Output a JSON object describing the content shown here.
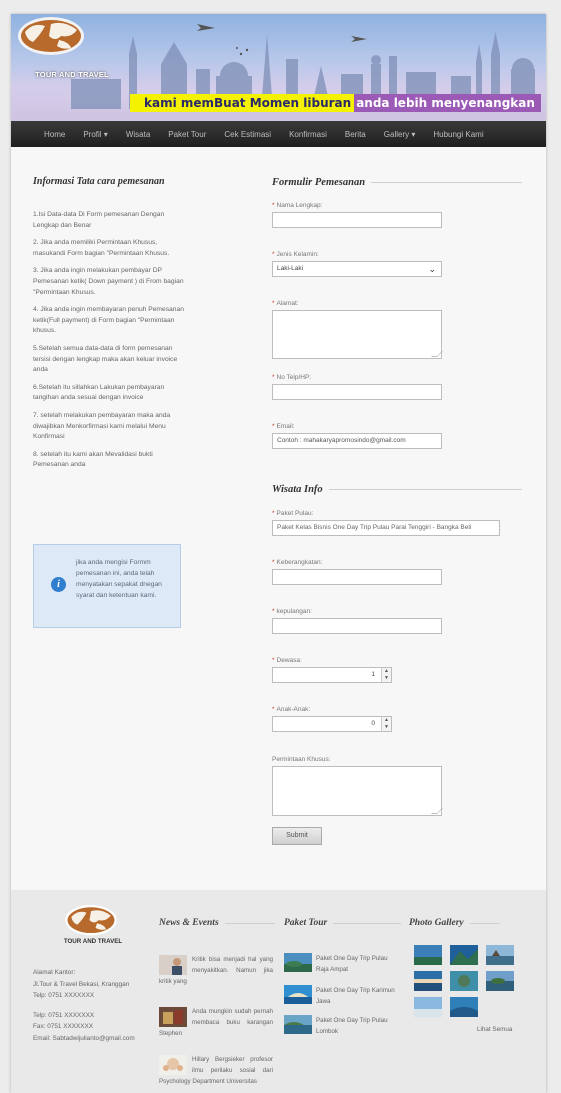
{
  "brand": {
    "logo_text": "TOUR AND TRAVEL",
    "tagline_highlight": "kami memBuat Momen liburan",
    "tagline_rest": "anda lebih menyenangkan"
  },
  "nav": {
    "items": [
      "Home",
      "Profil ▾",
      "Wisata",
      "Paket Tour",
      "Cek Estimasi",
      "Konfirmasi",
      "Berita",
      "Gallery ▾",
      "Hubungi Kami"
    ]
  },
  "info": {
    "title": "Informasi Tata cara pemesanan",
    "steps": [
      "1.Isi Data-data Di Form pemesanan Dengan Lengkap dan Benar",
      "2. Jika anda memiliki Permintaan Khusus, masukandi Form bagian \"Permintaan Khusus.",
      "3. Jika anda ingin melakukan pembayar DP Pemesanan ketik( Down payment ) di From bagian \"Permintaan Khusus.",
      "4. Jika anda ingin membayaran penuh Pemesanan ketik(Full payment) di Form bagian \"Permintaan khusus.",
      "5.Setelah semua data-data di form pemesanan tersisi dengan lengkap maka akan keluar invoice anda",
      "6.Setelah itu sillahkan Lakukan pembayaran tangihan anda sesuai dengan invoice",
      "7. setelah melakukan pembayaran maka anda diwajibkan Menkorfirmasi kami melalui Menu Konfirmasi",
      "8. setelah itu kami akan Mevalidasi bukti Pemesanan anda"
    ],
    "notice": "jika anda mengisi Formm pemesanan ini, anda telah menyatakan sepakat dnegan syarat dan ketentuan kami."
  },
  "form": {
    "heading": "Formulir Pemesanan",
    "required_mark": "*",
    "nama_label": "Nama Lengkap:",
    "nama_value": "",
    "jk_label": "Jenis Kelamin:",
    "jk_value": "Laki-Laki",
    "alamat_label": "Alamat:",
    "telp_label": "No Telp/HP:",
    "email_label": "Email:",
    "email_value": "Contoh : mahakaryapromosindo@gmail.com"
  },
  "wisata": {
    "heading": "Wisata Info",
    "paket_label": "Paket Pulau:",
    "paket_value": "Paket Kelas Bisnis One Day Trip Pulau Parai Tenggiri - Bangka Beli",
    "berangkat_label": "Keberangkatan:",
    "pulang_label": "kepulangan:",
    "dewasa_label": "Dewasa:",
    "dewasa_value": "1",
    "anak_label": "Anak-Anak:",
    "anak_value": "0",
    "khusus_label": "Permintaan Khusus:",
    "submit_label": "Submit"
  },
  "footer": {
    "logo_text": "TOUR AND TRAVEL",
    "address_lines": [
      "Alamat Kantor:",
      "Jl.Tour & Travel Bekasi, Kranggan",
      "Telp: 0751 XXXXXXX",
      "",
      "Telp: 0751 XXXXXXX",
      "Fax: 0751 XXXXXXX",
      "Email: Sabtadwijulianto@gmail.com"
    ],
    "news_heading": "News & Events",
    "news": [
      "Kritik bisa menjadi hal yang menyakitkan. Namun jika kritik yang",
      "Anda mungkin sudah pernah membaca buku karangan Stephen",
      "Hillary Bergsieker profesor ilmu perilaku sosial dari Psychology Department Universitas"
    ],
    "tour_heading": "Paket Tour",
    "tours": [
      "Paket One Day Trip Pulau Raja Ampat",
      "Paket One Day Trip Karimun Jawa",
      "Paket One Day Trip Pulau Lombok"
    ],
    "gallery_heading": "Photo Gallery",
    "see_all": "Lihat Semua"
  },
  "colors": {
    "tag_yellow": "#f4f200",
    "tag_purple": "#9b5ab6",
    "nav_bg": "#262626",
    "info_blue": "#2f7fce"
  }
}
